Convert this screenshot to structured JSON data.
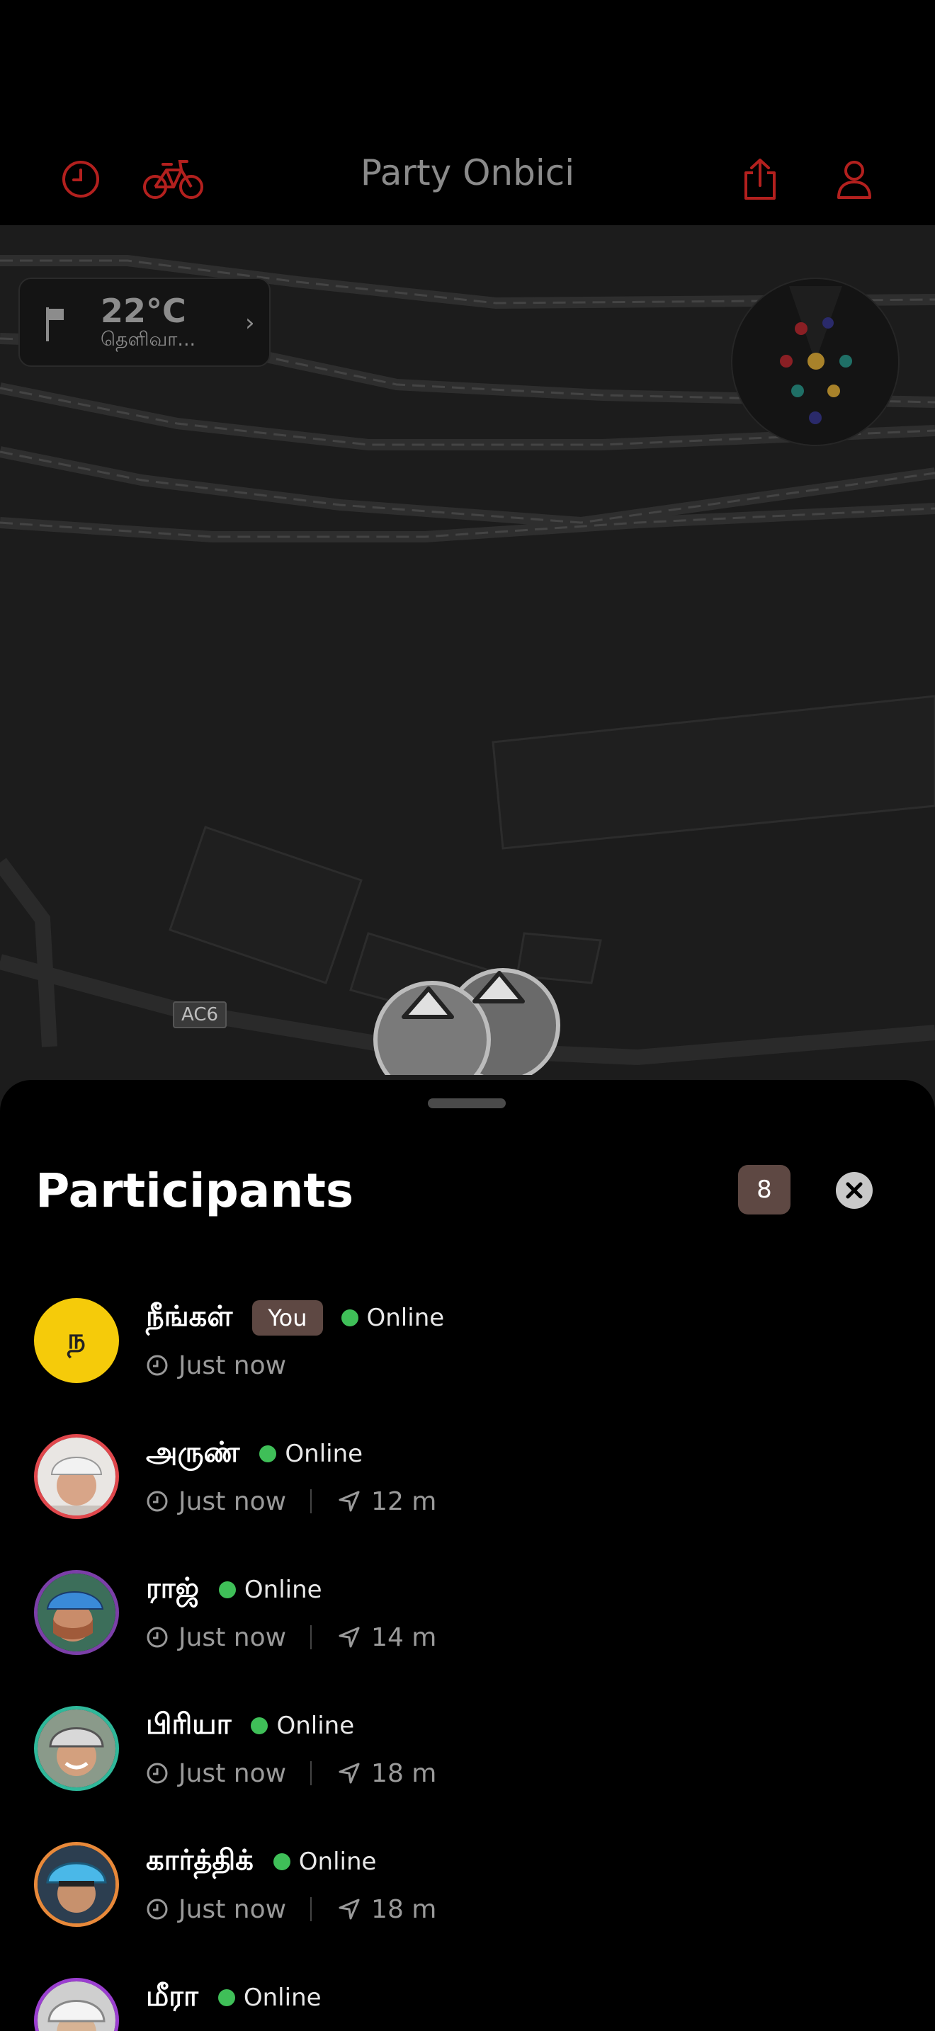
{
  "app": {
    "title": "Party Onbici"
  },
  "weather": {
    "temperature": "22°C",
    "description": "தெளிவா..."
  },
  "map": {
    "road_label": "AC6"
  },
  "sheet": {
    "title": "Participants",
    "count": "8"
  },
  "participants": [
    {
      "name": "நீங்கள்",
      "initial": "ந",
      "you_label": "You",
      "status": "Online",
      "time": "Just now",
      "distance": null
    },
    {
      "name": "அருண்",
      "status": "Online",
      "time": "Just now",
      "distance": "12 m",
      "ring": "#e0474c"
    },
    {
      "name": "ராஜ்",
      "status": "Online",
      "time": "Just now",
      "distance": "14 m",
      "ring": "#7b3fa8"
    },
    {
      "name": "பிரியா",
      "status": "Online",
      "time": "Just now",
      "distance": "18 m",
      "ring": "#2fb89a"
    },
    {
      "name": "கார்த்திக்",
      "status": "Online",
      "time": "Just now",
      "distance": "18 m",
      "ring": "#e8893a"
    },
    {
      "name": "மீரா",
      "status": "Online",
      "time": null,
      "distance": null,
      "ring": "#9b3fd0"
    }
  ],
  "colors": {
    "accent_red": "#b3201e",
    "online_green": "#3fbf58",
    "badge_brown": "#5e4843",
    "you_avatar_yellow": "#f5cb0a"
  },
  "icons": [
    "clock-icon",
    "bicycle-icon",
    "share-icon",
    "profile-icon",
    "flag-icon",
    "chevron-right-icon",
    "close-icon",
    "navigation-arrow-icon"
  ]
}
